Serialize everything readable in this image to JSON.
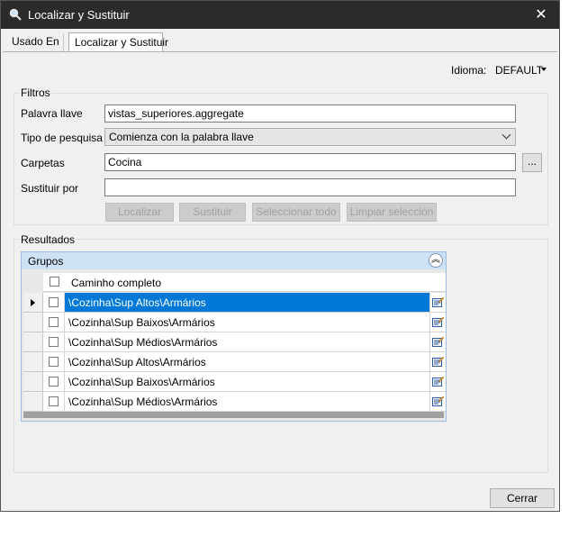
{
  "window": {
    "title": "Localizar y Sustituir",
    "close_glyph": "✕"
  },
  "tabs": [
    {
      "label": "Usado En",
      "active": false
    },
    {
      "label": "Localizar y Sustituir",
      "active": true
    }
  ],
  "language": {
    "label": "Idioma:",
    "value": "DEFAULT"
  },
  "filters": {
    "group_label": "Filtros",
    "keyword_label": "Palavra llave",
    "keyword_value": "vistas_superiores.aggregate",
    "search_type_label": "Tipo de pesquisa",
    "search_type_value": "Comienza con la palabra llave",
    "folders_label": "Carpetas",
    "folders_value": "Cocina",
    "browse_label": "...",
    "replace_label": "Sustituir por",
    "replace_value": ""
  },
  "actions": {
    "find": "Localizar",
    "replace": "Sustituir",
    "select_all": "Seleccionar todo",
    "clear_selection": "Limpiar selección"
  },
  "results": {
    "group_label": "Resultados",
    "grid_title": "Grupos",
    "column_header": "Caminho completo",
    "rows": [
      {
        "path": "\\Cozinha\\Sup Altos\\Armários",
        "selected": true
      },
      {
        "path": "\\Cozinha\\Sup Baixos\\Armários",
        "selected": false
      },
      {
        "path": "\\Cozinha\\Sup Médios\\Armários",
        "selected": false
      },
      {
        "path": "\\Cozinha\\Sup Altos\\Armários",
        "selected": false
      },
      {
        "path": "\\Cozinha\\Sup Baixos\\Armários",
        "selected": false
      },
      {
        "path": "\\Cozinha\\Sup Médios\\Armários",
        "selected": false
      }
    ]
  },
  "footer": {
    "close_label": "Cerrar"
  },
  "colors": {
    "selection": "#0078d7",
    "grid_header": "#cfe2f5",
    "titlebar": "#2b2b2b"
  }
}
